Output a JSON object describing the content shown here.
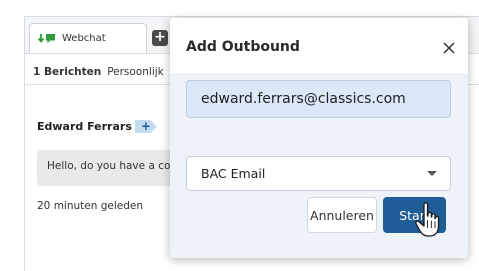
{
  "chat": {
    "tab_label": "Webchat",
    "add_tab_label": "+",
    "message_count": "1 Berichten",
    "personal_label": "Persoonlijk",
    "contact_name": "Edward Ferrars",
    "add_contact_label": "+",
    "message_text": "Hello, do you have a co",
    "timestamp": "20 minuten geleden"
  },
  "modal": {
    "title": "Add Outbound",
    "email_value": "edward.ferrars@classics.com",
    "channel_selected": "BAC Email",
    "cancel_label": "Annuleren",
    "start_label": "Start"
  },
  "icons": {
    "tab_icon": "webchat-icon",
    "close": "close-icon",
    "dropdown": "chevron-down-icon",
    "cursor": "hand-pointer-icon"
  },
  "colors": {
    "accent": "#1f5d96",
    "webchat_green": "#2e9c3a",
    "modal_body_bg": "#eef3fa",
    "input_bg": "#dbe8f7"
  }
}
